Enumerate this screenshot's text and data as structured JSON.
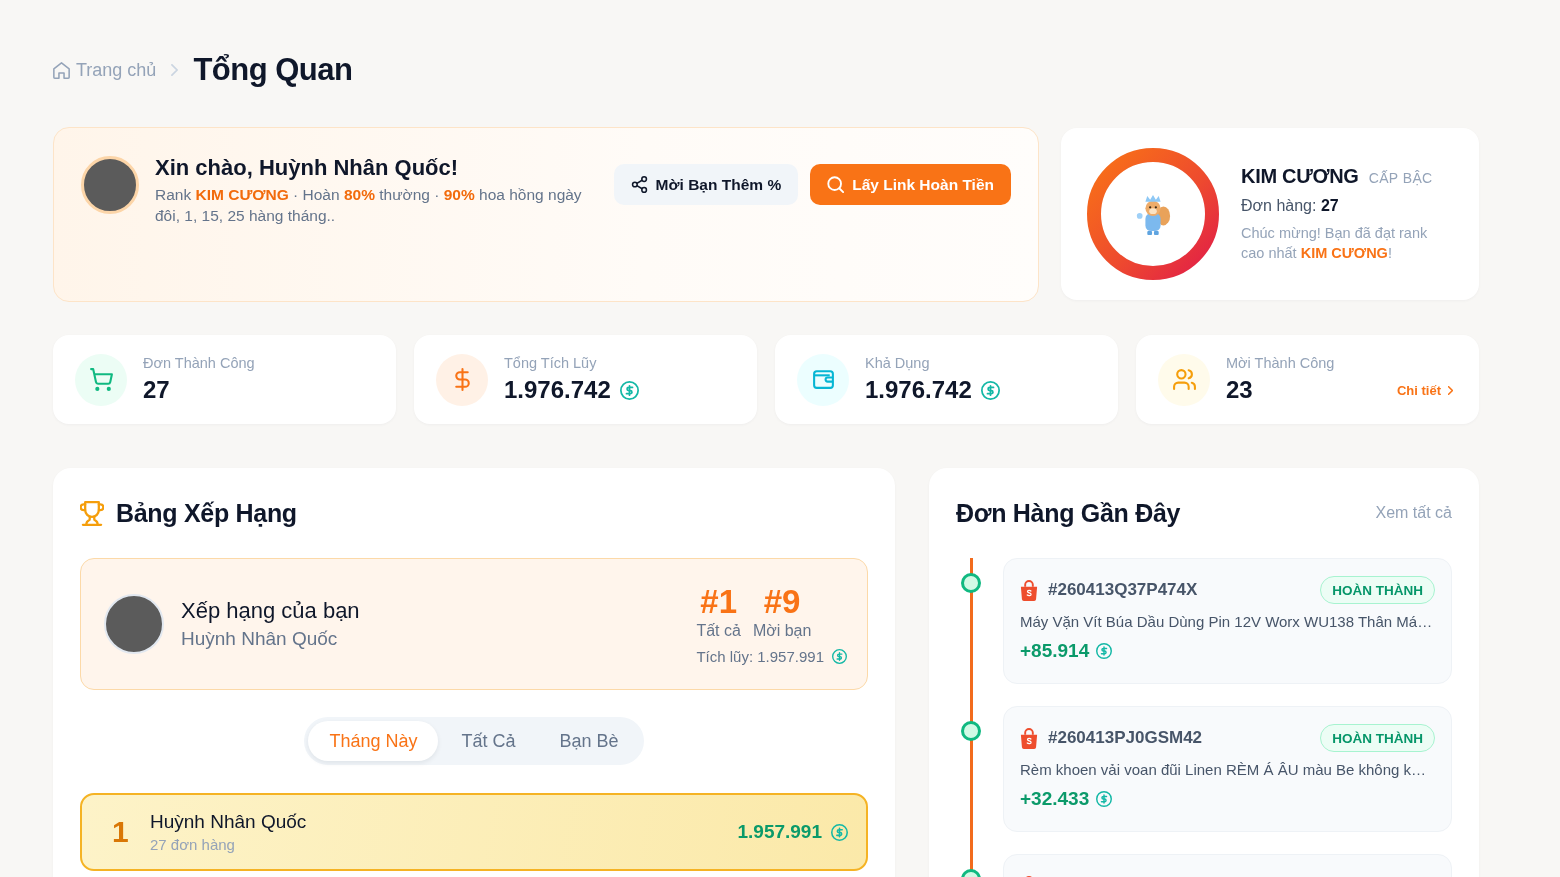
{
  "breadcrumb": {
    "home": "Trang chủ",
    "current": "Tổng Quan"
  },
  "greeting": {
    "title": "Xin chào, Huỳnh Nhân Quốc!",
    "subtitle": "Rank **KIM CƯƠNG** · Hoàn **80%** thường · **90%** hoa hồng ngày đôi, 1, 15, 25 hàng tháng..",
    "buttons": [
      {
        "kind": "invite",
        "label": "Mời Bạn Thêm %"
      },
      {
        "kind": "get-link",
        "label": "Lấy Link Hoàn Tiền"
      }
    ]
  },
  "rank": {
    "name": "KIM CƯƠNG",
    "label": "CẤP BẬC",
    "orders": "Đơn hàng: **27**",
    "message": "Chúc mừng! Bạn đã đạt rank cao nhất **KIM CƯƠNG**!",
    "level": 1
  },
  "stats": [
    {
      "kind": "orders",
      "label": "Đơn Thành Công",
      "value": "27",
      "coin": false
    },
    {
      "kind": "cashback",
      "label": "Tổng Tích Lũy",
      "value": "1.976.742",
      "coin": true
    },
    {
      "kind": "balance",
      "label": "Khả Dụng",
      "value": "1.976.742",
      "coin": true
    },
    {
      "kind": "invites",
      "label": "Mời Thành Công",
      "value": "23",
      "coin": false,
      "link": "Chi tiết"
    }
  ],
  "leaderboard": {
    "title": "Bảng Xếp Hạng",
    "my_rank": {
      "title": "Xếp hạng của bạn",
      "name": "Huỳnh Nhân Quốc",
      "ranks": [
        {
          "value": "#1",
          "label": "Tất cả"
        },
        {
          "value": "#9",
          "label": "Mời bạn"
        }
      ],
      "total": "Tích lũy: 1.957.991"
    },
    "tabs": [
      {
        "label": "Tháng Này",
        "selected": true
      },
      {
        "label": "Tất Cả",
        "selected": false
      },
      {
        "label": "Bạn Bè",
        "selected": false
      }
    ],
    "rows": [
      {
        "kind": "gold",
        "rank": "1",
        "name": "Huỳnh Nhân Quốc",
        "orders": "27 đơn hàng",
        "amount": "1.957.991"
      }
    ]
  },
  "recent_orders": {
    "title": "Đơn Hàng Gần Đây",
    "link": "Xem tất cả",
    "items": [
      {
        "id": "#260413Q37P474X",
        "status": "HOÀN THÀNH",
        "product": "Máy Vặn Vít Búa Dầu Dùng Pin 12V Worx WU138 Thân Má…",
        "amount": "+85.914"
      },
      {
        "id": "#260413PJ0GSM42",
        "status": "HOÀN THÀNH",
        "product": "Rèm khoen vải voan đũi Linen RÈM Á ÂU màu Be không k…",
        "amount": "+32.433"
      }
    ],
    "partial_item_below": true
  }
}
